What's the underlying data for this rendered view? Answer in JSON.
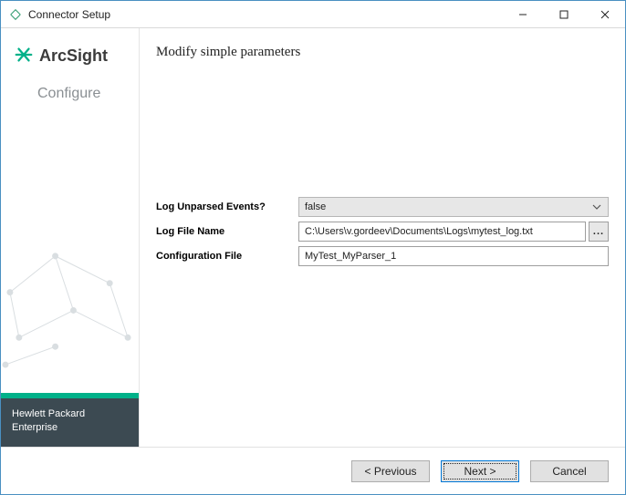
{
  "window": {
    "title": "Connector Setup"
  },
  "brand": {
    "name": "ArcSight",
    "subtitle": "Configure"
  },
  "sidebarFooter": {
    "line1": "Hewlett Packard",
    "line2": "Enterprise"
  },
  "main": {
    "heading": "Modify simple parameters"
  },
  "form": {
    "logUnparsed": {
      "label": "Log Unparsed Events?",
      "value": "false"
    },
    "logFileName": {
      "label": "Log File Name",
      "value": "C:\\Users\\v.gordeev\\Documents\\Logs\\mytest_log.txt",
      "browse": "..."
    },
    "configFile": {
      "label": "Configuration File",
      "value": "MyTest_MyParser_1"
    }
  },
  "buttons": {
    "previous": "< Previous",
    "next": "Next >",
    "cancel": "Cancel"
  }
}
